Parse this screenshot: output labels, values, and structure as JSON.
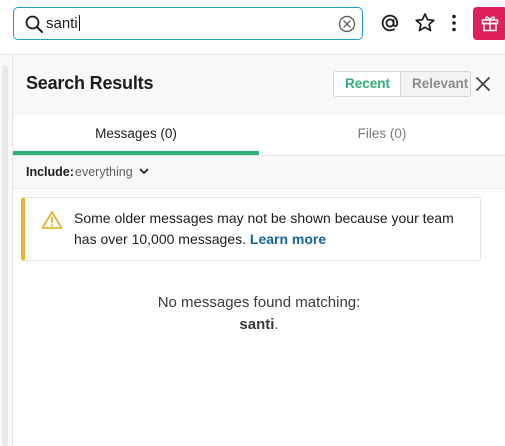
{
  "search": {
    "query": "santi",
    "clear_icon": "close-circle-icon"
  },
  "topbar": {
    "icons": [
      "mention-icon",
      "star-icon",
      "more-vertical-icon",
      "gift-icon"
    ],
    "gift_color": "#e01e5a"
  },
  "panel": {
    "title": "Search Results",
    "sort": {
      "recent_label": "Recent",
      "relevant_label": "Relevant",
      "active": "Recent"
    },
    "tabs": [
      {
        "label": "Messages (0)",
        "active": true
      },
      {
        "label": "Files (0)",
        "active": false
      }
    ],
    "include": {
      "label": "Include:",
      "value": "everything"
    },
    "notice": {
      "text": "Some older messages may not be shown because your team has over 10,000 messages.",
      "link": "Learn more"
    },
    "empty": {
      "line1": "No messages found matching:",
      "query": "santi",
      "suffix": "."
    }
  },
  "colors": {
    "accent_green": "#2eaf78",
    "link_blue": "#1264a3",
    "warning_yellow": "#ecb22e",
    "search_border": "#1d9bd1"
  }
}
